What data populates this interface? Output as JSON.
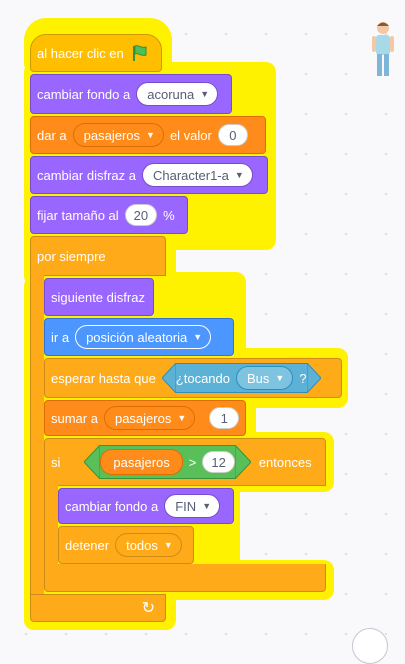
{
  "script": {
    "hat_label": "al hacer clic en",
    "flag_icon": "green-flag-icon",
    "switch_backdrop_label": "cambiar fondo a",
    "backdrop_value": "acoruna",
    "set_label": "dar a",
    "set_var": "pasajeros",
    "set_value_label": "el valor",
    "set_value": "0",
    "switch_costume_label": "cambiar disfraz a",
    "costume_value": "Character1-a",
    "size_label": "fijar tamaño al",
    "size_value": "20",
    "size_unit": "%",
    "forever_label": "por siempre",
    "next_costume_label": "siguiente disfraz",
    "goto_label": "ir a",
    "goto_value": "posición aleatoria",
    "wait_label": "esperar hasta que",
    "touching_label": "¿tocando",
    "touching_value": "Bus",
    "touching_q": "?",
    "change_label": "sumar a",
    "change_var": "pasajeros",
    "change_value": "1",
    "if_label": "si",
    "if_var": "pasajeros",
    "if_op": ">",
    "if_value": "12",
    "then_label": "entonces",
    "inner_backdrop_label": "cambiar fondo a",
    "inner_backdrop_value": "FIN",
    "stop_label": "detener",
    "stop_value": "todos",
    "loop_arrow": "↻"
  },
  "sprite_icon": "character-sprite-icon",
  "colors": {
    "events": "#ffbf00",
    "looks": "#9966ff",
    "variables": "#ff8c1a",
    "control": "#ffab19",
    "motion": "#4c97ff",
    "sensing": "#5cb1d6",
    "operators": "#59c059",
    "highlight": "#fff200"
  }
}
